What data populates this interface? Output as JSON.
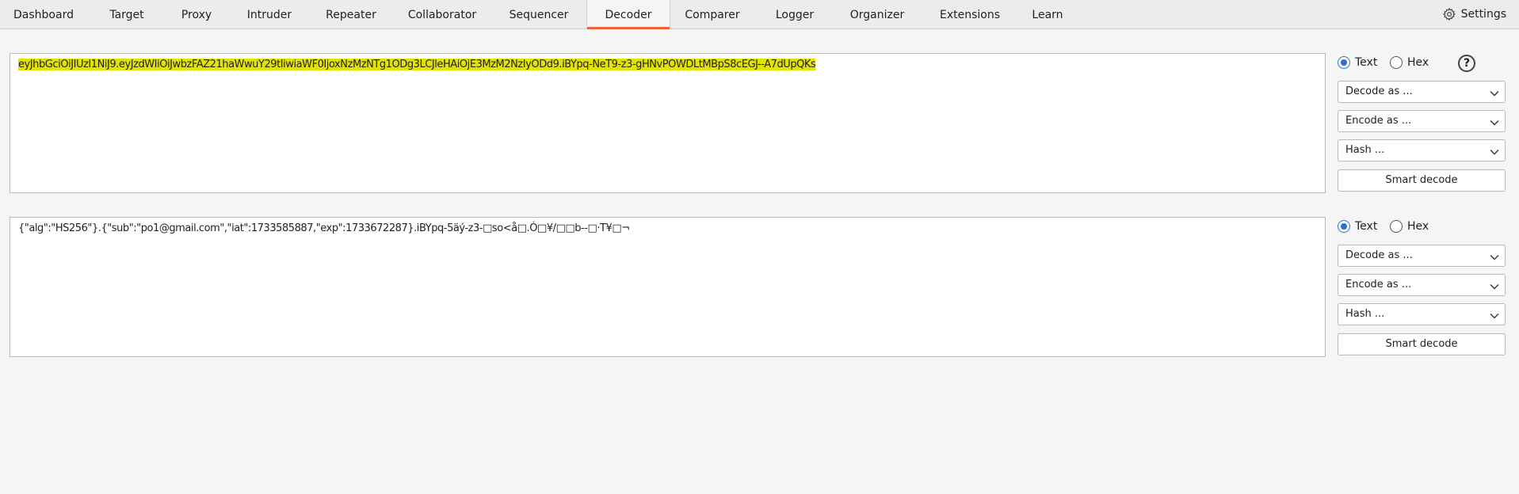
{
  "tabs": [
    "Dashboard",
    "Target",
    "Proxy",
    "Intruder",
    "Repeater",
    "Collaborator",
    "Sequencer",
    "Decoder",
    "Comparer",
    "Logger",
    "Organizer",
    "Extensions",
    "Learn"
  ],
  "active_tab": "Decoder",
  "settings_label": "Settings",
  "panels": [
    {
      "content": "eyJhbGciOiJIUzI1NiJ9.eyJzdWIiOiJwbzFAZ21haWwuY29tIiwiaWF0IjoxNzMzNTg1ODg3LCJleHAiOjE3MzM2NzIyODd9.iBYpq-NeT9-z3-gHNvPOWDLtMBpS8cEGJ--A7dUpQKs",
      "highlighted": true,
      "radio_text": "Text",
      "radio_hex": "Hex",
      "selected": "Text",
      "decode_label": "Decode as ...",
      "encode_label": "Encode as ...",
      "hash_label": "Hash ...",
      "smart_label": "Smart decode"
    },
    {
      "content": "{\"alg\":\"HS256\"}.{\"sub\":\"po1@gmail.com\",\"iat\":1733585887,\"exp\":1733672287}.iBYpq-5äý-z3-□so<å□.Ó□¥/□□b--□·T¥□¬",
      "highlighted": false,
      "radio_text": "Text",
      "radio_hex": "Hex",
      "selected": "Text",
      "decode_label": "Decode as ...",
      "encode_label": "Encode as ...",
      "hash_label": "Hash ...",
      "smart_label": "Smart decode"
    }
  ],
  "colors": {
    "accent": "#e8653a",
    "highlight": "#e3e300",
    "radio": "#2a6fd6"
  }
}
